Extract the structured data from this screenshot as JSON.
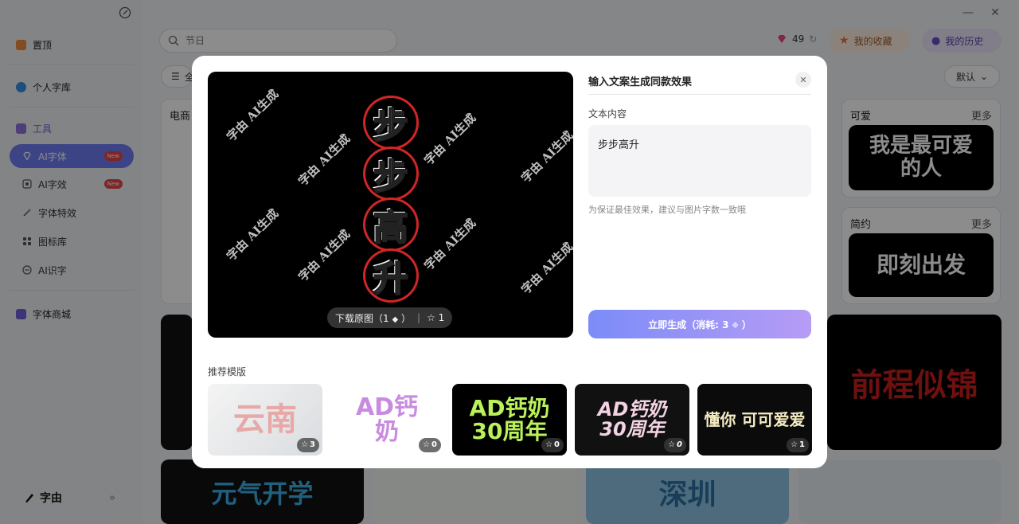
{
  "sidebar": {
    "pin_label": "置顶",
    "personal_label": "个人字库",
    "tools_label": "工具",
    "items": [
      {
        "label": "AI字体",
        "badge": "New",
        "active": true
      },
      {
        "label": "AI字效",
        "badge": "New",
        "active": false
      },
      {
        "label": "字体特效"
      },
      {
        "label": "图标库"
      },
      {
        "label": "AI识字"
      }
    ],
    "store_label": "字体商城",
    "brand": "字由",
    "expand_icon": "double-chevron-right-icon"
  },
  "topbar": {
    "search_placeholder": "节日",
    "credits": "49",
    "favorites_label": "我的收藏",
    "history_label": "我的历史",
    "sort_label": "默认",
    "filter_label": "全"
  },
  "background_cards": {
    "card1_title": "电商",
    "card2_title": "可爱",
    "card2_more": "更多",
    "card2_art": "我是最可爱的人",
    "card3_title": "简约",
    "card3_more": "更多",
    "card3_art": "即刻出发",
    "tile_art_1": "前程似锦",
    "tile_art_2": "元气开学",
    "tile_art_3": "深圳"
  },
  "modal": {
    "title": "输入文案生成同款效果",
    "field_label": "文本内容",
    "text_value": "步步高升",
    "hint": "为保证最佳效果，建议与图片字数一致哦",
    "generate_label": "立即生成（消耗: 3",
    "generate_suffix": "）",
    "download_label": "下载原图（1",
    "download_suffix": "）",
    "fav_count": "1",
    "watermark": "字由 AI生成",
    "art_chars": [
      "步",
      "步",
      "高",
      "升"
    ],
    "recommend_label": "推荐模版",
    "templates": [
      {
        "text": "云南",
        "count": "3"
      },
      {
        "text": "AD钙奶",
        "count": "0"
      },
      {
        "text": "AD钙奶30周年",
        "count": "0"
      },
      {
        "text": "AD钙奶30周年",
        "count": "0"
      },
      {
        "text": "懂你 可可爱爱",
        "count": "1"
      }
    ]
  },
  "colors": {
    "accent": "#6d7cf5",
    "badge": "#e64545",
    "art_ring": "#d12626"
  }
}
